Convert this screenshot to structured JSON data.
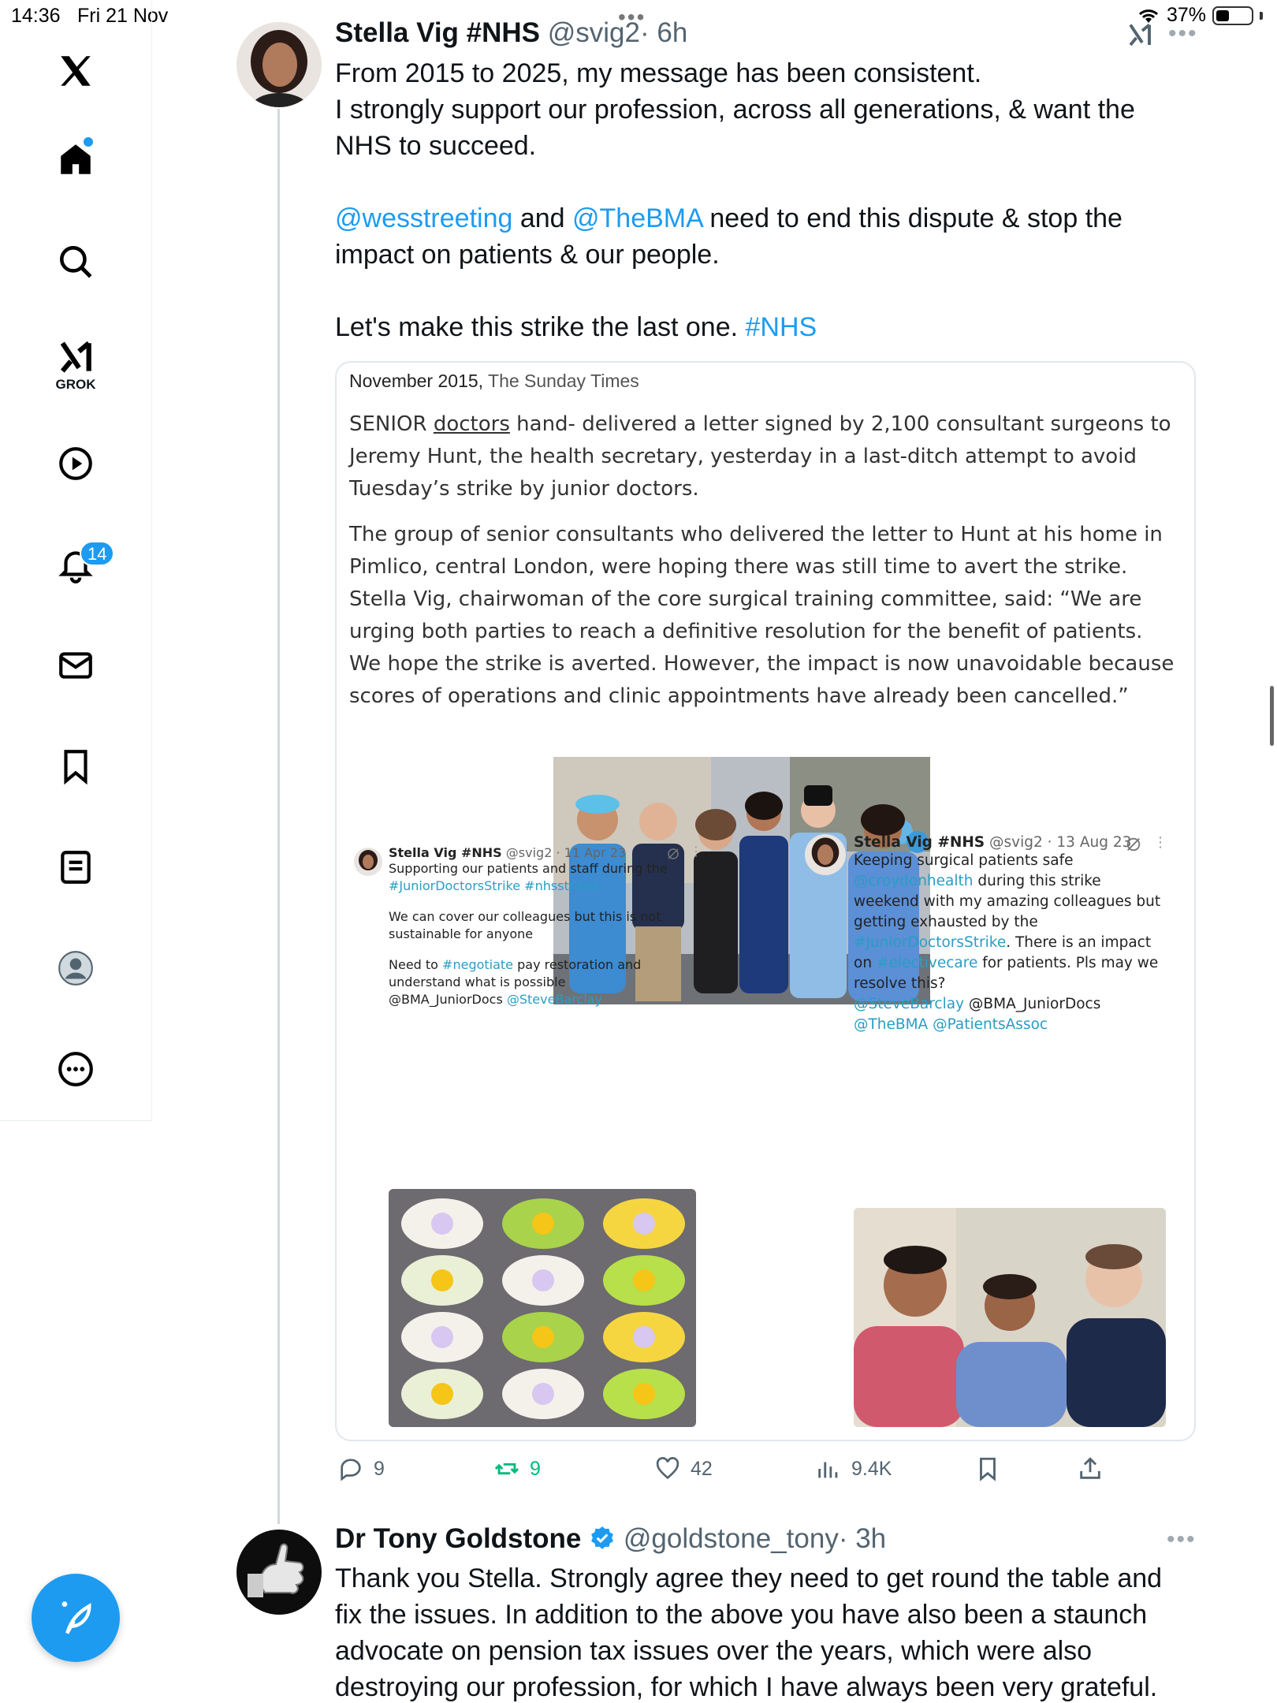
{
  "status_bar": {
    "time": "14:36",
    "date": "Fri 21 Nov",
    "battery": "37%",
    "battery_level": 0.37
  },
  "sidebar": {
    "grok_label": "GROK",
    "notification_count": "14"
  },
  "main_tweet": {
    "author_name": "Stella Vig #NHS",
    "handle": "@svig2",
    "time": "· 6h",
    "lines": [
      "From 2015 to 2025, my message has been consistent.",
      "I strongly support our profession, across all generations, & want the",
      "NHS to succeed."
    ],
    "mention_1": "@wesstreeting",
    "and_text": " and ",
    "mention_2": "@TheBMA",
    "dispute_text": "  need to end this dispute & stop the",
    "dispute_line_2": "impact on patients & our people.",
    "closing_text": "Let's make this strike the last one. ",
    "closing_hashtag": "#NHS"
  },
  "card": {
    "source_date": "November 2015,",
    "source_paper": " The Sunday Times",
    "para1_lead": "SENIOR ",
    "para1_underlined": "doctors",
    "para1_rest": " hand- delivered a letter signed by 2,100 consultant surgeons to Jeremy Hunt, the health secretary, yesterday in a last-ditch attempt to avoid Tuesday’s strike by junior doctors.",
    "para2": "The group of senior consultants who delivered the letter to Hunt at his home in Pimlico, central London, were hoping there was still time to avert the strike. Stella Vig, chairwoman of the core surgical training committee, said: “We are urging both parties to reach a definitive resolution for the benefit of patients. We hope the strike is averted. However, the impact is now unavoidable because scores of operations and clinic appointments have already been cancelled.”"
  },
  "mini_tweet_1": {
    "name": "Stella Vig #NHS",
    "handle": "@svig2 · 11 Apr 23",
    "line1": "Supporting our patients and staff during the",
    "tags": "#JuniorDoctorsStrike #nhsstrikes",
    "para2": "We can cover our colleagues but this is not sustainable for anyone",
    "para3_a": "Need to ",
    "para3_tag": "#negotiate",
    "para3_b": " pay restoration and understand what is possible",
    "para3_c": "@BMA_JuniorDocs ",
    "para3_tag2": "@SteveBarclay"
  },
  "mini_tweet_2": {
    "name": "Stella Vig #NHS",
    "handle": "@svig2 · 13 Aug 23",
    "line1": "Keeping surgical patients safe",
    "tag1": "@croydonhealth",
    "line2": " during this strike weekend with my amazing colleagues but getting exhausted by the ",
    "tag2": "#JuniorDoctorsStrike",
    "line3": ". There is an impact on ",
    "tag3": "#electivecare",
    "line4": " for patients. Pls may we resolve this?",
    "tag4": "@SteveBarclay",
    "line5": " @BMA_JuniorDocs",
    "tag5": "@TheBMA @PatientsAssoc"
  },
  "actions": {
    "replies": "9",
    "reposts": "9",
    "likes": "42",
    "views": "9.4K"
  },
  "reply_tweet": {
    "author_name": "Dr Tony Goldstone",
    "handle": "@goldstone_tony",
    "time": "· 3h",
    "lines": [
      "Thank you Stella. Strongly agree they need to get round the table and",
      "fix the issues. In addition to the above you have also been a staunch",
      "advocate on pension tax issues over the years, which were also",
      "destroying our profession, for which I have always been very grateful."
    ]
  },
  "colors": {
    "accent": "#1d9bf0",
    "repost_green": "#00ba7c",
    "text": "#0f1419",
    "muted": "#536471"
  }
}
